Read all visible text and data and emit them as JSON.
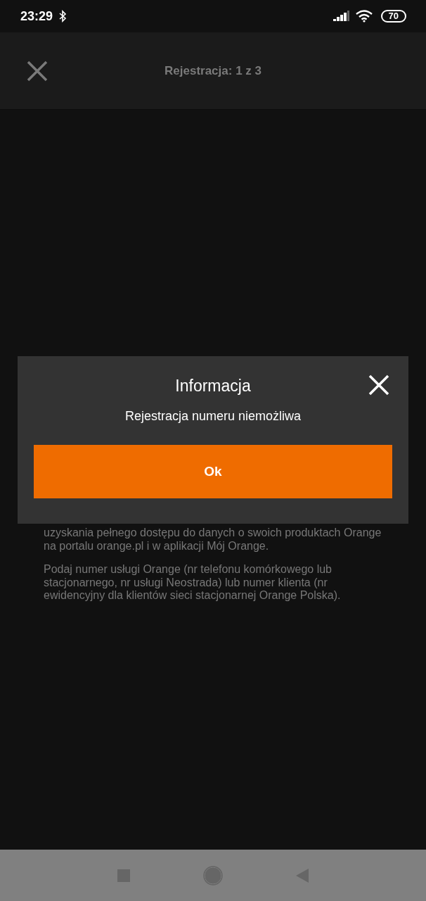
{
  "status_bar": {
    "time": "23:29",
    "battery": "70"
  },
  "header": {
    "title": "Rejestracja: 1 z 3"
  },
  "content": {
    "paragraphs": [
      "uzyskania pełnego dostępu do danych o swoich produktach Orange na portalu orange.pl i w aplikacji Mój Orange.",
      "Podaj numer usługi Orange (nr telefonu komórkowego lub stacjonarnego, nr usługi Neostrada) lub numer klienta (nr ewidencyjny dla klientów sieci stacjonarnej Orange Polska)."
    ]
  },
  "dialog": {
    "title": "Informacja",
    "message": "Rejestracja numeru niemożliwa",
    "button": "Ok"
  }
}
